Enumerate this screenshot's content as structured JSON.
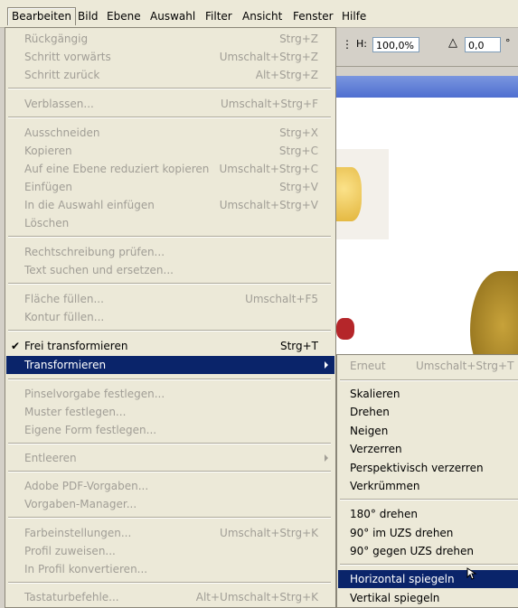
{
  "menubar": {
    "items": [
      "Bearbeiten",
      "Bild",
      "Ebene",
      "Auswahl",
      "Filter",
      "Ansicht",
      "Fenster",
      "Hilfe"
    ]
  },
  "options": {
    "h_label": "H:",
    "h_value": "100,0%",
    "angle_value": "0,0",
    "degree": "°"
  },
  "edit_menu": {
    "undo": {
      "label": "Rückgängig",
      "shortcut": "Strg+Z"
    },
    "step_forward": {
      "label": "Schritt vorwärts",
      "shortcut": "Umschalt+Strg+Z"
    },
    "step_back": {
      "label": "Schritt zurück",
      "shortcut": "Alt+Strg+Z"
    },
    "fade": {
      "label": "Verblassen...",
      "shortcut": "Umschalt+Strg+F"
    },
    "cut": {
      "label": "Ausschneiden",
      "shortcut": "Strg+X"
    },
    "copy": {
      "label": "Kopieren",
      "shortcut": "Strg+C"
    },
    "copy_merged": {
      "label": "Auf eine Ebene reduziert kopieren",
      "shortcut": "Umschalt+Strg+C"
    },
    "paste": {
      "label": "Einfügen",
      "shortcut": "Strg+V"
    },
    "paste_into": {
      "label": "In die Auswahl einfügen",
      "shortcut": "Umschalt+Strg+V"
    },
    "clear": {
      "label": "Löschen"
    },
    "spellcheck": {
      "label": "Rechtschreibung prüfen..."
    },
    "find_replace": {
      "label": "Text suchen und ersetzen..."
    },
    "fill": {
      "label": "Fläche füllen...",
      "shortcut": "Umschalt+F5"
    },
    "stroke": {
      "label": "Kontur füllen..."
    },
    "free_transform": {
      "label": "Frei transformieren",
      "shortcut": "Strg+T"
    },
    "transform": {
      "label": "Transformieren"
    },
    "define_brush": {
      "label": "Pinselvorgabe festlegen..."
    },
    "define_pattern": {
      "label": "Muster festlegen..."
    },
    "define_shape": {
      "label": "Eigene Form festlegen..."
    },
    "purge": {
      "label": "Entleeren"
    },
    "pdf_presets": {
      "label": "Adobe PDF-Vorgaben..."
    },
    "preset_manager": {
      "label": "Vorgaben-Manager..."
    },
    "color_settings": {
      "label": "Farbeinstellungen...",
      "shortcut": "Umschalt+Strg+K"
    },
    "assign_profile": {
      "label": "Profil zuweisen..."
    },
    "convert_profile": {
      "label": "In Profil konvertieren..."
    },
    "keyboard_shortcuts": {
      "label": "Tastaturbefehle...",
      "shortcut": "Alt+Umschalt+Strg+K"
    }
  },
  "transform_menu": {
    "again": {
      "label": "Erneut",
      "shortcut": "Umschalt+Strg+T"
    },
    "scale": "Skalieren",
    "rotate": "Drehen",
    "skew": "Neigen",
    "distort": "Verzerren",
    "perspective": "Perspektivisch verzerren",
    "warp": "Verkrümmen",
    "rotate180": "180° drehen",
    "rotate90cw": "90° im UZS drehen",
    "rotate90ccw": "90° gegen UZS drehen",
    "flip_h": "Horizontal spiegeln",
    "flip_v": "Vertikal spiegeln"
  },
  "colors": {
    "highlight": "#0a246a",
    "menu_bg": "#ece9d8",
    "disabled_text": "#a19e96"
  }
}
